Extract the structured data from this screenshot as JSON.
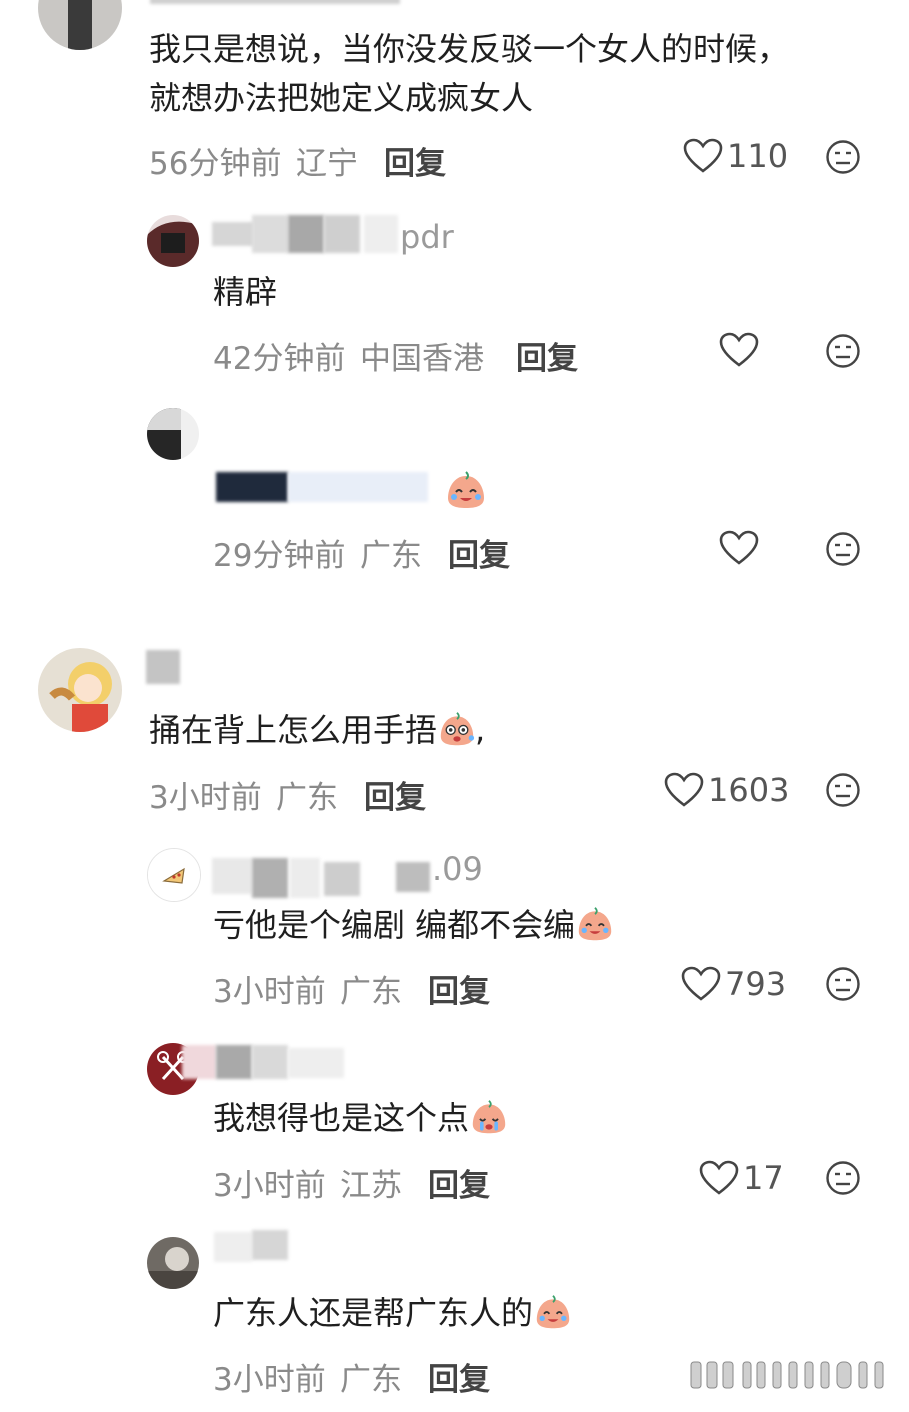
{
  "comments": [
    {
      "id": "c1",
      "name": "",
      "text_line1": "我只是想说，当你没发反驳一个女人的时候，",
      "text_line2": "就想办法把她定义成疯女人",
      "time": "56分钟前",
      "location": "辽宁",
      "reply_label": "回复",
      "likes": "110"
    },
    {
      "id": "r1",
      "name": "pdr",
      "text": "精辟",
      "time": "42分钟前",
      "location": "中国香港",
      "reply_label": "回复",
      "likes": ""
    },
    {
      "id": "r2",
      "name": "",
      "text": "",
      "time": "29分钟前",
      "location": "广东",
      "reply_label": "回复",
      "likes": ""
    },
    {
      "id": "c2",
      "name": "",
      "text": "捅在背上怎么用手捂",
      "text_suffix": ",",
      "time": "3小时前",
      "location": "广东",
      "reply_label": "回复",
      "likes": "1603"
    },
    {
      "id": "r3",
      "name": ".09",
      "text": "亏他是个编剧 编都不会编",
      "time": "3小时前",
      "location": "广东",
      "reply_label": "回复",
      "likes": "793"
    },
    {
      "id": "r4",
      "name": "",
      "text": "我想得也是这个点",
      "time": "3小时前",
      "location": "江苏",
      "reply_label": "回复",
      "likes": "17"
    },
    {
      "id": "r5",
      "name": "",
      "text": "广东人还是帮广东人的",
      "time": "3小时前",
      "location": "广东",
      "reply_label": "回复",
      "likes": ""
    }
  ],
  "colors": {
    "meta": "#8a8a8a",
    "text": "#1f1f1f",
    "icon": "#444444",
    "emoji": "#f4a78c"
  }
}
